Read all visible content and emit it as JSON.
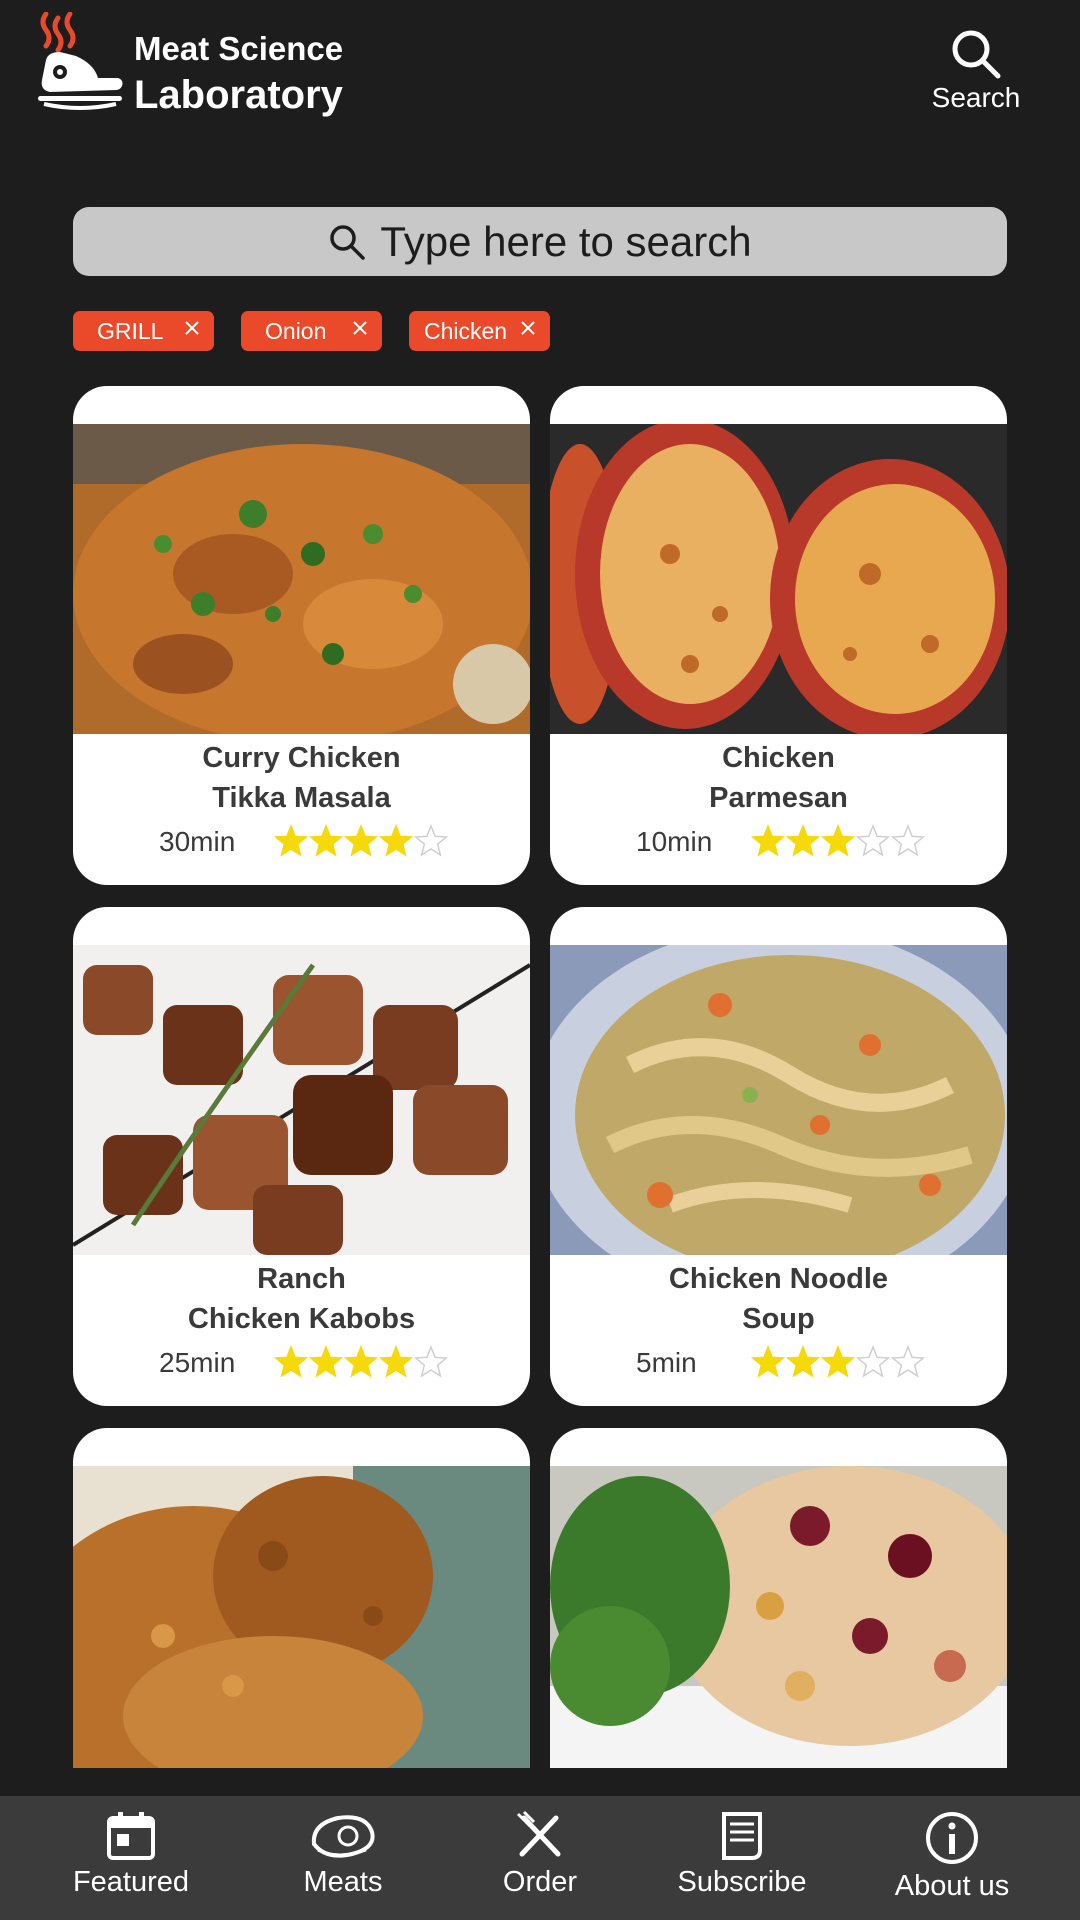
{
  "app": {
    "brand_line1": "Meat Science",
    "brand_line2": "Laboratory",
    "search_action_label": "Search"
  },
  "search": {
    "placeholder": "Type here to search"
  },
  "filters": [
    {
      "label": "GRILL"
    },
    {
      "label": "Onion"
    },
    {
      "label": "Chicken"
    }
  ],
  "recipes": [
    {
      "title_line1": "Curry Chicken",
      "title_line2": "Tikka Masala",
      "time": "30min",
      "rating": 4,
      "max_rating": 5
    },
    {
      "title_line1": "Chicken",
      "title_line2": "Parmesan",
      "time": "10min",
      "rating": 3,
      "max_rating": 5
    },
    {
      "title_line1": "Ranch",
      "title_line2": "Chicken Kabobs",
      "time": "25min",
      "rating": 4,
      "max_rating": 5
    },
    {
      "title_line1": "Chicken Noodle",
      "title_line2": "Soup",
      "time": "5min",
      "rating": 3,
      "max_rating": 5
    }
  ],
  "nav": [
    {
      "label": "Featured",
      "icon": "calendar-icon"
    },
    {
      "label": "Meats",
      "icon": "meat-icon"
    },
    {
      "label": "Order",
      "icon": "utensils-icon"
    },
    {
      "label": "Subscribe",
      "icon": "document-icon"
    },
    {
      "label": "About us",
      "icon": "info-icon"
    }
  ],
  "colors": {
    "background": "#1d1d1e",
    "accent": "#ea4a2a",
    "star": "#f5d90a",
    "navbar": "#3b3b3c"
  }
}
